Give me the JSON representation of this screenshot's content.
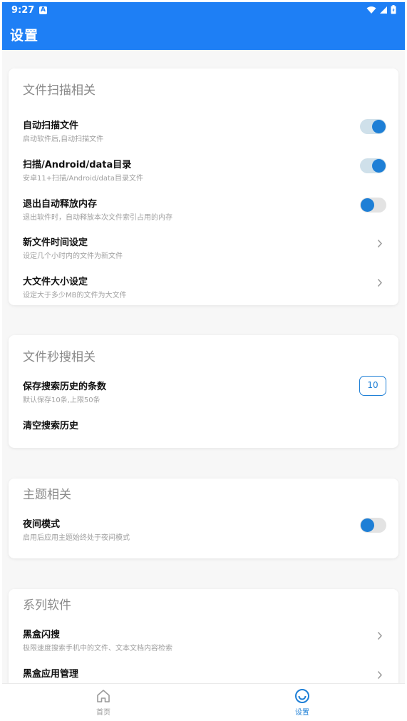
{
  "status_bar": {
    "time": "9:27",
    "notification_icon": "A"
  },
  "app_bar": {
    "title": "设置"
  },
  "sections": [
    {
      "title": "文件扫描相关",
      "items": [
        {
          "title": "自动扫描文件",
          "subtitle": "启动软件后,自动扫描文件",
          "control": "toggle",
          "state": "on"
        },
        {
          "title": "扫描/Android/data目录",
          "subtitle": "安卓11+扫描/Android/data目录文件",
          "control": "toggle",
          "state": "on"
        },
        {
          "title": "退出自动释放内存",
          "subtitle": "退出软件时，自动释放本次文件索引占用的内存",
          "control": "toggle",
          "state": "off"
        },
        {
          "title": "新文件时间设定",
          "subtitle": "设定几个小时内的文件为新文件",
          "control": "chevron"
        },
        {
          "title": "大文件大小设定",
          "subtitle": "设定大于多少MB的文件为大文件",
          "control": "chevron"
        }
      ]
    },
    {
      "title": "文件秒搜相关",
      "items": [
        {
          "title": "保存搜索历史的条数",
          "subtitle": "默认保存10条,上限50条",
          "control": "number",
          "value": "10"
        },
        {
          "title": "清空搜索历史",
          "subtitle": "",
          "control": "none"
        }
      ]
    },
    {
      "title": "主题相关",
      "items": [
        {
          "title": "夜间模式",
          "subtitle": "启用后应用主题始终处于夜间模式",
          "control": "toggle",
          "state": "off"
        }
      ]
    },
    {
      "title": "系列软件",
      "items": [
        {
          "title": "黑盒闪搜",
          "subtitle": "极限速度搜索手机中的文件、文本文档内容检索",
          "control": "chevron"
        },
        {
          "title": "黑盒应用管理",
          "subtitle": "",
          "control": "chevron"
        }
      ]
    }
  ],
  "bottom_nav": [
    {
      "label": "首页",
      "icon": "home-icon",
      "active": false
    },
    {
      "label": "设置",
      "icon": "smile-icon",
      "active": true
    }
  ],
  "colors": {
    "primary": "#1e7ff5",
    "accent": "#1e7fd6",
    "inactive": "#9a9a9a"
  }
}
